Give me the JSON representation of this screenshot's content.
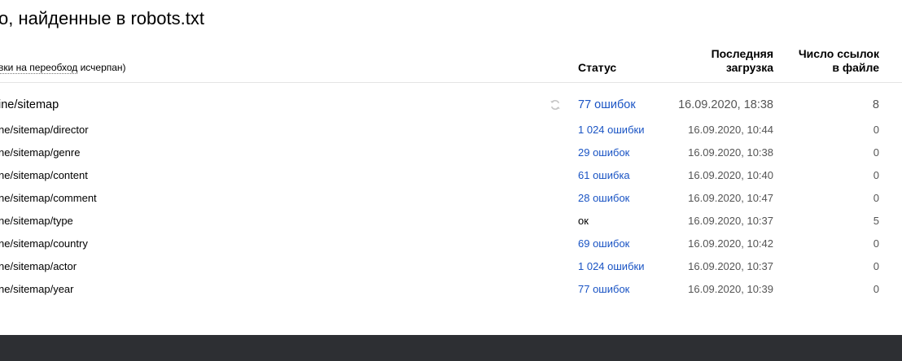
{
  "heading": "о, найденные в robots.txt",
  "subnote": {
    "prefix": "вки на переобход",
    "suffix": " исчерпан)"
  },
  "columns": {
    "status": "Статус",
    "last_load_line1": "Последняя",
    "last_load_line2": "загрузка",
    "links_line1": "Число ссылок",
    "links_line2": "в файле"
  },
  "rows": [
    {
      "url": "ine/sitemap",
      "status": "77 ошибок",
      "date": "16.09.2020, 18:38",
      "count": "8"
    },
    {
      "url": "ne/sitemap/director",
      "status": "1 024 ошибки",
      "date": "16.09.2020, 10:44",
      "count": "0"
    },
    {
      "url": "ne/sitemap/genre",
      "status": "29 ошибок",
      "date": "16.09.2020, 10:38",
      "count": "0"
    },
    {
      "url": "ne/sitemap/content",
      "status": "61 ошибка",
      "date": "16.09.2020, 10:40",
      "count": "0"
    },
    {
      "url": "ne/sitemap/comment",
      "status": "28 ошибок",
      "date": "16.09.2020, 10:47",
      "count": "0"
    },
    {
      "url": "ne/sitemap/type",
      "status": "ок",
      "date": "16.09.2020, 10:37",
      "count": "5"
    },
    {
      "url": "ne/sitemap/country",
      "status": "69 ошибок",
      "date": "16.09.2020, 10:42",
      "count": "0"
    },
    {
      "url": "ne/sitemap/actor",
      "status": "1 024 ошибки",
      "date": "16.09.2020, 10:37",
      "count": "0"
    },
    {
      "url": "ne/sitemap/year",
      "status": "77 ошибок",
      "date": "16.09.2020, 10:39",
      "count": "0"
    }
  ],
  "colors": {
    "link": "#1a54c4",
    "muted": "#555555",
    "footer": "#2d2f33"
  },
  "icons": {
    "refresh": "refresh-icon"
  }
}
